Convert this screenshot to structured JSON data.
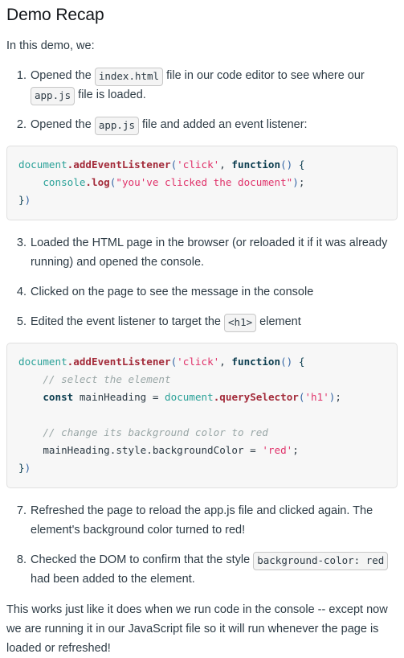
{
  "page": {
    "title": "Demo Recap",
    "intro": "In this demo, we:",
    "closing": "This works just like it does when we run code in the console -- except now we are running it in our JavaScript file so it will run whenever the page is loaded or refreshed!"
  },
  "steps": [
    {
      "number": "1.",
      "parts": [
        {
          "type": "text",
          "value": "Opened the "
        },
        {
          "type": "code",
          "value": "index.html"
        },
        {
          "type": "text",
          "value": " file in our code editor to see where our "
        },
        {
          "type": "code",
          "value": "app.js"
        },
        {
          "type": "text",
          "value": " file is loaded."
        }
      ]
    },
    {
      "number": "2.",
      "parts": [
        {
          "type": "text",
          "value": "Opened the "
        },
        {
          "type": "code",
          "value": "app.js"
        },
        {
          "type": "text",
          "value": " file and added an event listener:"
        }
      ]
    },
    {
      "number": "3.",
      "parts": [
        {
          "type": "text",
          "value": "Loaded the HTML page in the browser (or reloaded it if it was already running) and opened the console."
        }
      ]
    },
    {
      "number": "4.",
      "parts": [
        {
          "type": "text",
          "value": "Clicked on the page to see the message in the console"
        }
      ]
    },
    {
      "number": "5.",
      "parts": [
        {
          "type": "text",
          "value": "Edited the event listener to target the "
        },
        {
          "type": "code",
          "value": "<h1>"
        },
        {
          "type": "text",
          "value": " element"
        }
      ]
    },
    {
      "number": "7.",
      "parts": [
        {
          "type": "text",
          "value": "Refreshed the page to reload the app.js file and clicked again. The element's background color turned to red!"
        }
      ]
    },
    {
      "number": "8.",
      "parts": [
        {
          "type": "text",
          "value": "Checked the DOM to confirm that the style "
        },
        {
          "type": "code",
          "value": "background-color: red"
        },
        {
          "type": "text",
          "value": " had been added to the element."
        }
      ]
    }
  ],
  "code_blocks": [
    {
      "id": "code-block-1",
      "language": "javascript",
      "plain_text": "document.addEventListener('click', function() {\n    console.log(\"you've clicked the document\");\n})",
      "lines": [
        [
          {
            "t": "obj",
            "v": "document"
          },
          {
            "t": "meth",
            "v": ".addEventListener"
          },
          {
            "t": "paren",
            "v": "("
          },
          {
            "t": "str",
            "v": "'click'"
          },
          {
            "t": "punc",
            "v": ", "
          },
          {
            "t": "kw",
            "v": "function"
          },
          {
            "t": "paren",
            "v": "()"
          },
          {
            "t": "plain",
            "v": " "
          },
          {
            "t": "brace",
            "v": "{"
          }
        ],
        [
          {
            "t": "plain",
            "v": "    "
          },
          {
            "t": "obj",
            "v": "console"
          },
          {
            "t": "meth",
            "v": ".log"
          },
          {
            "t": "paren",
            "v": "("
          },
          {
            "t": "str",
            "v": "\"you've clicked the document\""
          },
          {
            "t": "paren",
            "v": ")"
          },
          {
            "t": "punc",
            "v": ";"
          }
        ],
        [
          {
            "t": "brace",
            "v": "}"
          },
          {
            "t": "paren",
            "v": ")"
          }
        ]
      ]
    },
    {
      "id": "code-block-2",
      "language": "javascript",
      "plain_text": "document.addEventListener('click', function() {\n    // select the element\n    const mainHeading = document.querySelector('h1');\n\n    // change its background color to red\n    mainHeading.style.backgroundColor = 'red';\n})",
      "lines": [
        [
          {
            "t": "obj",
            "v": "document"
          },
          {
            "t": "meth",
            "v": ".addEventListener"
          },
          {
            "t": "paren",
            "v": "("
          },
          {
            "t": "str",
            "v": "'click'"
          },
          {
            "t": "punc",
            "v": ", "
          },
          {
            "t": "kw",
            "v": "function"
          },
          {
            "t": "paren",
            "v": "()"
          },
          {
            "t": "plain",
            "v": " "
          },
          {
            "t": "brace",
            "v": "{"
          }
        ],
        [
          {
            "t": "plain",
            "v": "    "
          },
          {
            "t": "com",
            "v": "// select the element"
          }
        ],
        [
          {
            "t": "plain",
            "v": "    "
          },
          {
            "t": "kw",
            "v": "const"
          },
          {
            "t": "plain",
            "v": " mainHeading "
          },
          {
            "t": "op",
            "v": "="
          },
          {
            "t": "plain",
            "v": " "
          },
          {
            "t": "obj",
            "v": "document"
          },
          {
            "t": "meth",
            "v": ".querySelector"
          },
          {
            "t": "paren",
            "v": "("
          },
          {
            "t": "str",
            "v": "'h1'"
          },
          {
            "t": "paren",
            "v": ")"
          },
          {
            "t": "punc",
            "v": ";"
          }
        ],
        [
          {
            "t": "plain",
            "v": ""
          }
        ],
        [
          {
            "t": "plain",
            "v": "    "
          },
          {
            "t": "com",
            "v": "// change its background color to red"
          }
        ],
        [
          {
            "t": "plain",
            "v": "    "
          },
          {
            "t": "plain",
            "v": "mainHeading.style.backgroundColor"
          },
          {
            "t": "plain",
            "v": " "
          },
          {
            "t": "op",
            "v": "="
          },
          {
            "t": "plain",
            "v": " "
          },
          {
            "t": "str",
            "v": "'red'"
          },
          {
            "t": "punc",
            "v": ";"
          }
        ],
        [
          {
            "t": "brace",
            "v": "}"
          },
          {
            "t": "paren",
            "v": ")"
          }
        ]
      ]
    }
  ],
  "colors": {
    "background": "#ffffff",
    "body_text": "#2d3b45",
    "heading": "#13161a",
    "code_block_bg": "#f7f7f7",
    "code_block_border": "#e0e0e0",
    "chip_bg": "#f4f4f4",
    "chip_border": "#c7c7c7",
    "token_object": "#2aa198",
    "token_method": "#a32b3a",
    "token_string": "#e0326a",
    "token_keyword": "#0b3d4f",
    "token_comment": "#9aa7a7",
    "token_paren": "#3465a4"
  }
}
